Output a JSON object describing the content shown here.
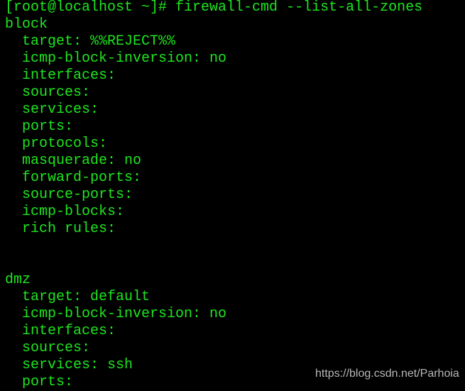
{
  "terminal": {
    "text_color": "#1ee61e",
    "background": "#000000",
    "lines": [
      "[root@localhost ~]# firewall-cmd --list-all-zones",
      "block",
      "  target: %%REJECT%%",
      "  icmp-block-inversion: no",
      "  interfaces:",
      "  sources:",
      "  services:",
      "  ports:",
      "  protocols:",
      "  masquerade: no",
      "  forward-ports:",
      "  source-ports:",
      "  icmp-blocks:",
      "  rich rules:",
      "",
      "",
      "dmz",
      "  target: default",
      "  icmp-block-inversion: no",
      "  interfaces:",
      "  sources:",
      "  services: ssh",
      "  ports:"
    ]
  },
  "watermark": "https://blog.csdn.net/Parhoia"
}
